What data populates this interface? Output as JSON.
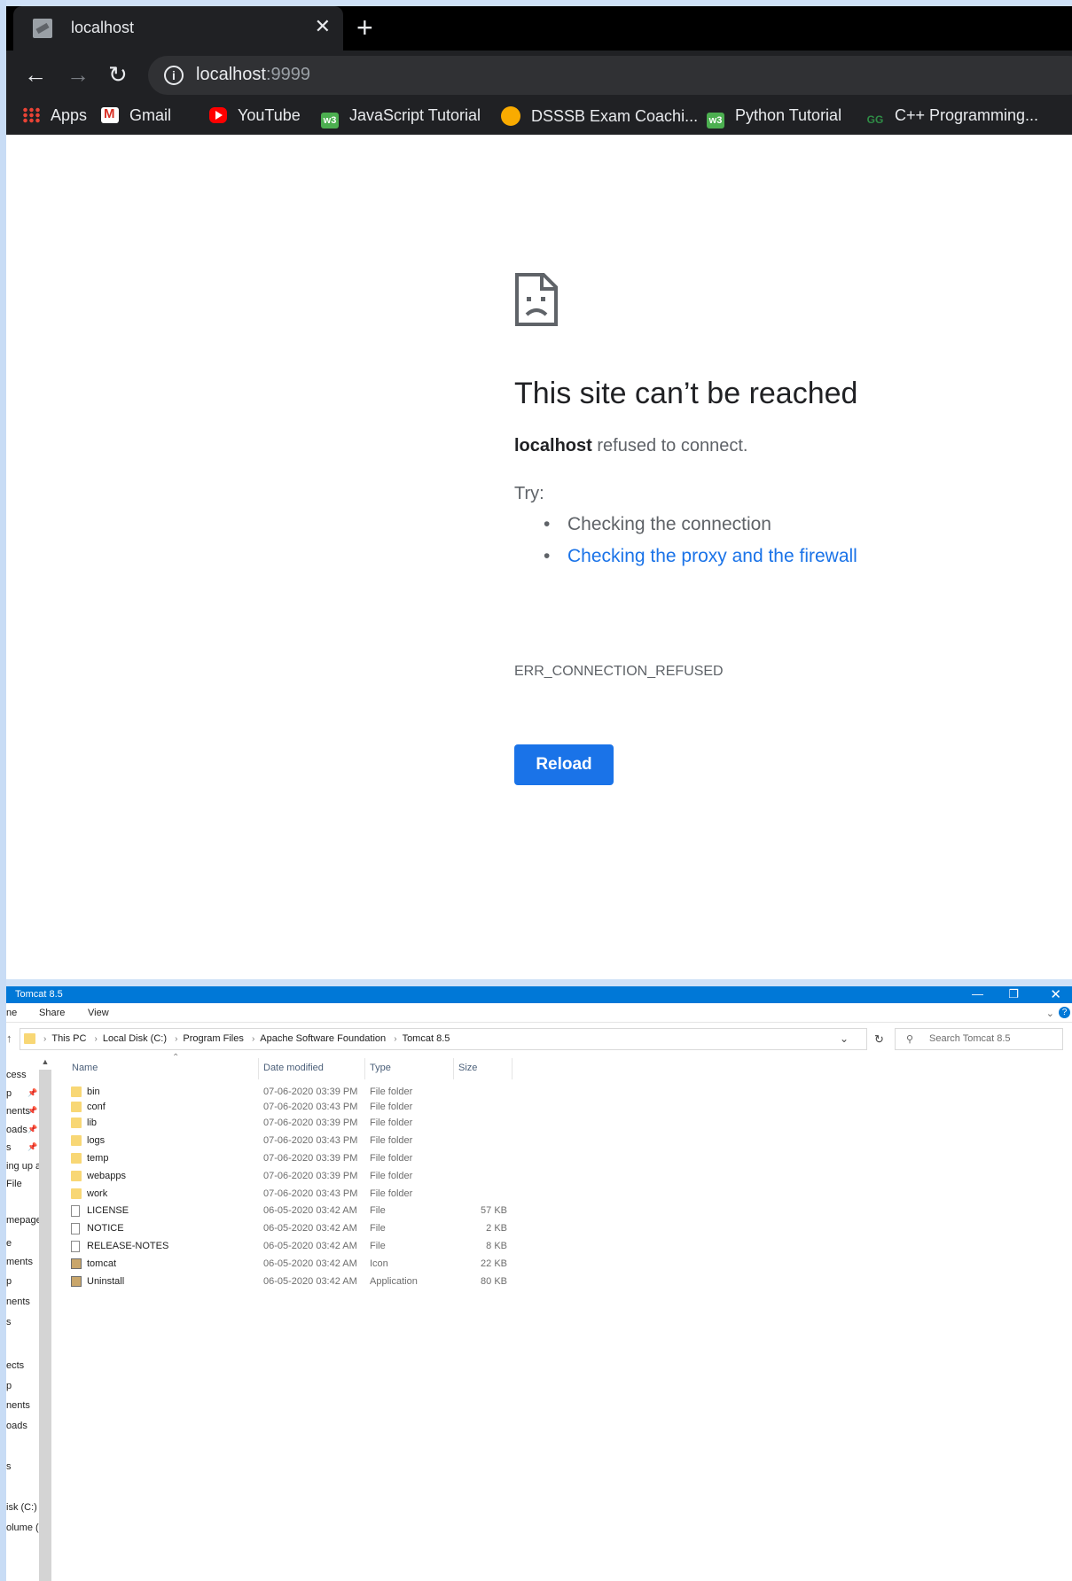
{
  "browser": {
    "tab_title": "localhost",
    "tab_close": "✕",
    "new_tab": "+",
    "url_host": "localhost",
    "url_port": ":9999",
    "bookmarks": [
      {
        "label": "Apps"
      },
      {
        "label": "Gmail"
      },
      {
        "label": "YouTube"
      },
      {
        "label": "JavaScript Tutorial"
      },
      {
        "label": "DSSSB Exam Coachi..."
      },
      {
        "label": "Python Tutorial"
      },
      {
        "label": "C++ Programming..."
      }
    ],
    "w3_glyph": "w3",
    "gfg_glyph": "GG"
  },
  "error_page": {
    "title": "This site can’t be reached",
    "host": "localhost",
    "message": " refused to connect.",
    "try_label": "Try:",
    "suggestions": [
      "Checking the connection",
      "Checking the proxy and the firewall"
    ],
    "error_code": "ERR_CONNECTION_REFUSED",
    "reload_label": "Reload"
  },
  "explorer": {
    "title": "Tomcat 8.5",
    "ribbon": [
      "ne",
      "Share",
      "View"
    ],
    "breadcrumb": [
      "This PC",
      "Local Disk (C:)",
      "Program Files",
      "Apache Software Foundation",
      "Tomcat 8.5"
    ],
    "search_placeholder": "Search Tomcat 8.5",
    "columns": {
      "name": "Name",
      "date": "Date modified",
      "type": "Type",
      "size": "Size"
    },
    "nav_items": [
      "cess",
      "p",
      "nents",
      "oads",
      "s",
      "ing up a",
      "File",
      "mepage",
      "e",
      "ments",
      "p",
      "nents",
      "s",
      "ects",
      "p",
      "nents",
      "oads",
      "s",
      "isk (C:)",
      "olume (I"
    ],
    "files": [
      {
        "name": "bin",
        "date": "07-06-2020 03:39 PM",
        "type": "File folder",
        "size": "",
        "icon": "folder"
      },
      {
        "name": "conf",
        "date": "07-06-2020 03:43 PM",
        "type": "File folder",
        "size": "",
        "icon": "folder"
      },
      {
        "name": "lib",
        "date": "07-06-2020 03:39 PM",
        "type": "File folder",
        "size": "",
        "icon": "folder"
      },
      {
        "name": "logs",
        "date": "07-06-2020 03:43 PM",
        "type": "File folder",
        "size": "",
        "icon": "folder"
      },
      {
        "name": "temp",
        "date": "07-06-2020 03:39 PM",
        "type": "File folder",
        "size": "",
        "icon": "folder"
      },
      {
        "name": "webapps",
        "date": "07-06-2020 03:39 PM",
        "type": "File folder",
        "size": "",
        "icon": "folder"
      },
      {
        "name": "work",
        "date": "07-06-2020 03:43 PM",
        "type": "File folder",
        "size": "",
        "icon": "folder"
      },
      {
        "name": "LICENSE",
        "date": "06-05-2020 03:42 AM",
        "type": "File",
        "size": "57 KB",
        "icon": "file"
      },
      {
        "name": "NOTICE",
        "date": "06-05-2020 03:42 AM",
        "type": "File",
        "size": "2 KB",
        "icon": "file"
      },
      {
        "name": "RELEASE-NOTES",
        "date": "06-05-2020 03:42 AM",
        "type": "File",
        "size": "8 KB",
        "icon": "file"
      },
      {
        "name": "tomcat",
        "date": "06-05-2020 03:42 AM",
        "type": "Icon",
        "size": "22 KB",
        "icon": "image"
      },
      {
        "name": "Uninstall",
        "date": "06-05-2020 03:42 AM",
        "type": "Application",
        "size": "80 KB",
        "icon": "image"
      }
    ]
  }
}
